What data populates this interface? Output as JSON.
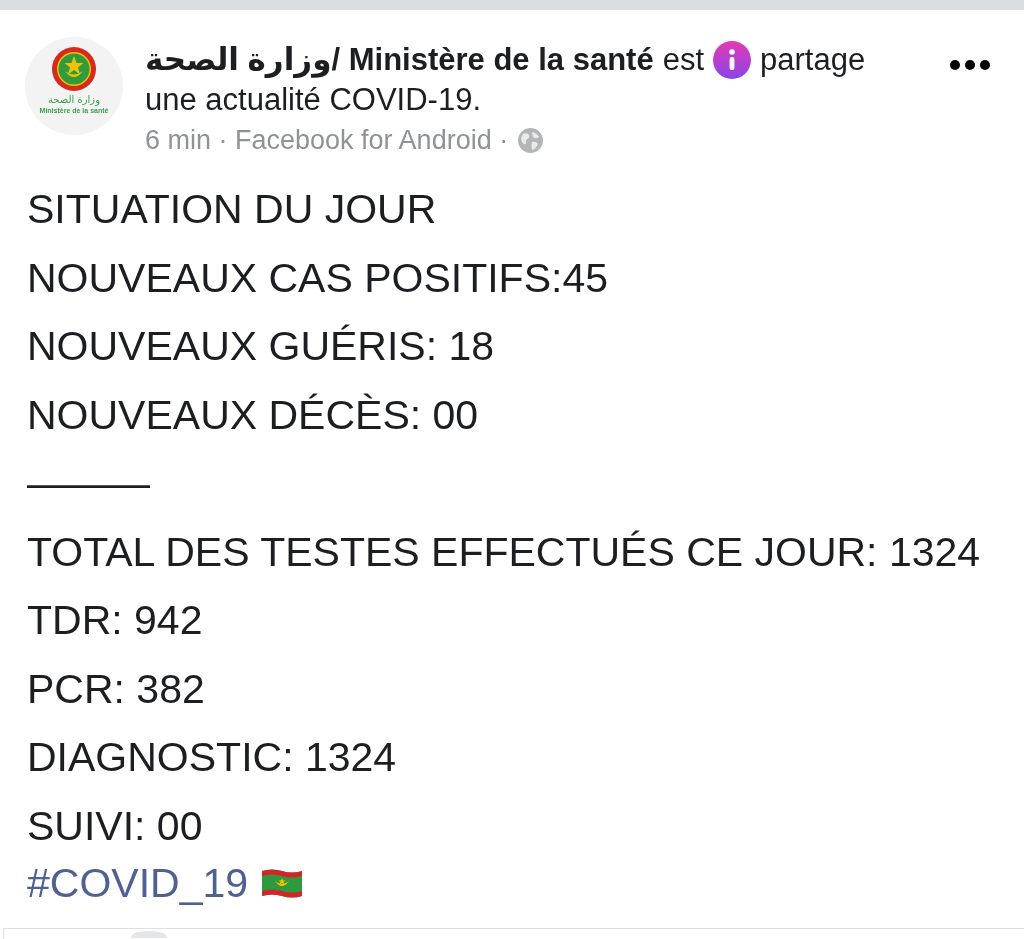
{
  "header": {
    "avatar": {
      "logo_text_ar": "وزارة الصحة",
      "logo_text_fr": "Ministère de la santé"
    },
    "author": "وزارة الصحة/ Ministère de la santé",
    "verb": "est",
    "activity_line_1": "partage",
    "activity_line_2": "une actualité COVID-19.",
    "meta": "6 min · Facebook for Android ·"
  },
  "body": {
    "lines": [
      "SITUATION DU JOUR",
      "NOUVEAUX CAS POSITIFS:45",
      "NOUVEAUX GUÉRIS: 18",
      "NOUVEAUX DÉCÈS: 00",
      "———",
      "TOTAL DES TESTES EFFECTUÉS CE JOUR: 1324",
      "TDR: 942",
      "PCR: 382",
      "DIAGNOSTIC: 1324",
      "SUIVI: 00"
    ],
    "hashtag": "#COVID_19"
  }
}
